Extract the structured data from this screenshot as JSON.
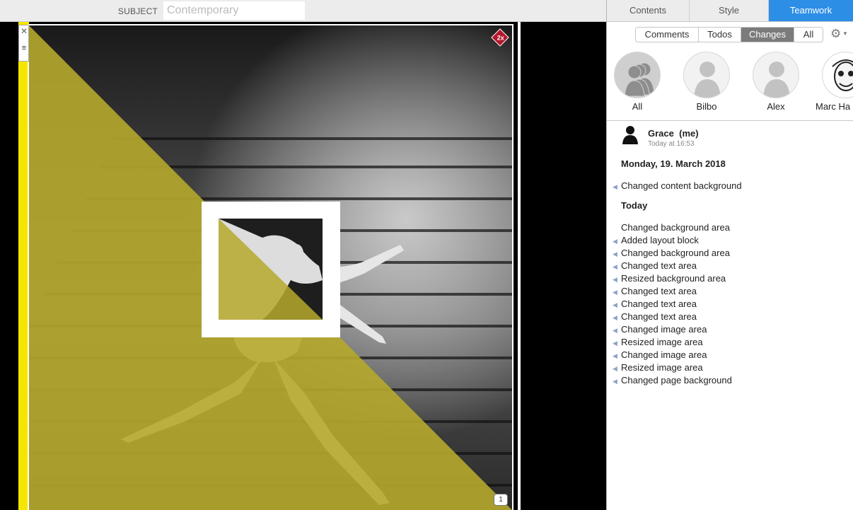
{
  "subject": {
    "label": "SUBJECT",
    "placeholder": "Contemporary"
  },
  "canvas": {
    "zoom_badge": "2x",
    "comment_count": "1"
  },
  "panel": {
    "tabs": [
      {
        "label": "Contents",
        "active": false
      },
      {
        "label": "Style",
        "active": false
      },
      {
        "label": "Teamwork",
        "active": true
      }
    ],
    "filters": [
      {
        "label": "Comments",
        "active": false
      },
      {
        "label": "Todos",
        "active": false
      },
      {
        "label": "Changes",
        "active": true
      },
      {
        "label": "All",
        "active": false
      }
    ],
    "users": [
      {
        "name": "All",
        "selected": true
      },
      {
        "name": "Bilbo",
        "selected": false
      },
      {
        "name": "Alex",
        "selected": false
      },
      {
        "name": "Marc Ha",
        "selected": false
      }
    ],
    "history": {
      "author": "Grace",
      "author_suffix": "(me)",
      "time": "Today at 16:53",
      "groups": [
        {
          "heading": "Monday, 19. March 2018",
          "items": [
            {
              "text": "Changed content background",
              "arrow": true
            }
          ]
        },
        {
          "heading": "Today",
          "items": [
            {
              "text": "Changed background area",
              "arrow": false
            },
            {
              "text": "Added layout block",
              "arrow": true
            },
            {
              "text": "Changed background area",
              "arrow": true
            },
            {
              "text": "Changed text area",
              "arrow": true
            },
            {
              "text": "Resized background area",
              "arrow": true
            },
            {
              "text": "Changed text area",
              "arrow": true
            },
            {
              "text": "Changed text area",
              "arrow": true
            },
            {
              "text": "Changed text area",
              "arrow": true
            },
            {
              "text": "Changed image area",
              "arrow": true
            },
            {
              "text": "Resized image area",
              "arrow": true
            },
            {
              "text": "Changed image area",
              "arrow": true
            },
            {
              "text": "Resized image area",
              "arrow": true
            },
            {
              "text": "Changed page background",
              "arrow": true
            }
          ]
        }
      ]
    }
  },
  "colors": {
    "accent": "#2d8ee6",
    "overlay_yellow": "#b5a92c",
    "strip_yellow": "#f4e600",
    "badge_red": "#b2182b"
  }
}
